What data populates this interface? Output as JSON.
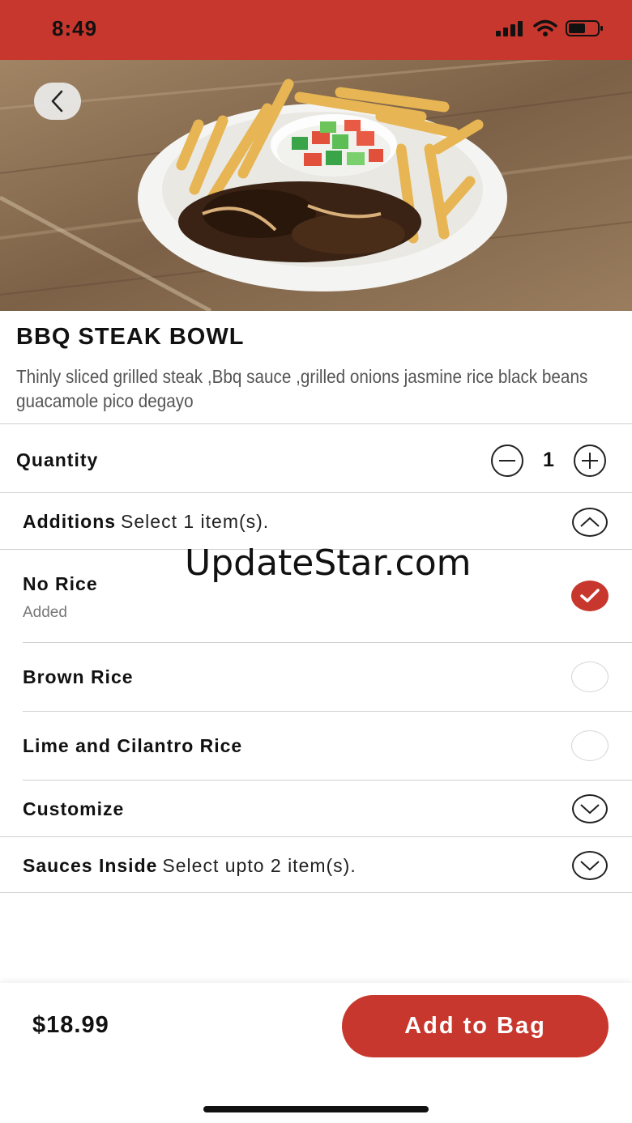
{
  "status": {
    "time": "8:49",
    "signal_icon": "signal-bars-icon",
    "wifi_icon": "wifi-icon",
    "battery_icon": "battery-icon"
  },
  "colors": {
    "brand": "#c8372d",
    "text": "#111111",
    "muted": "#777777"
  },
  "hero": {
    "image": "bbq-steak-bowl-photo",
    "back_icon": "chevron-left-icon"
  },
  "product": {
    "title": "BBQ STEAK BOWL",
    "description": "Thinly sliced grilled steak ,Bbq sauce ,grilled onions jasmine rice black beans guacamole pico degayo"
  },
  "quantity": {
    "label": "Quantity",
    "value": "1",
    "minus_icon": "minus-circle-icon",
    "plus_icon": "plus-circle-icon"
  },
  "additions": {
    "label": "Additions",
    "hint": "Select 1 item(s).",
    "expanded": true,
    "items": [
      {
        "label": "No Rice",
        "status": "Added",
        "selected": true
      },
      {
        "label": "Brown Rice",
        "selected": false
      },
      {
        "label": "Lime and Cilantro Rice",
        "selected": false
      }
    ]
  },
  "customize": {
    "label": "Customize",
    "expanded": false
  },
  "sauces": {
    "label": "Sauces Inside",
    "hint": "Select upto 2 item(s).",
    "expanded": false
  },
  "watermark": "UpdateStar.com",
  "footer": {
    "price": "$18.99",
    "add_label": "Add to Bag"
  }
}
